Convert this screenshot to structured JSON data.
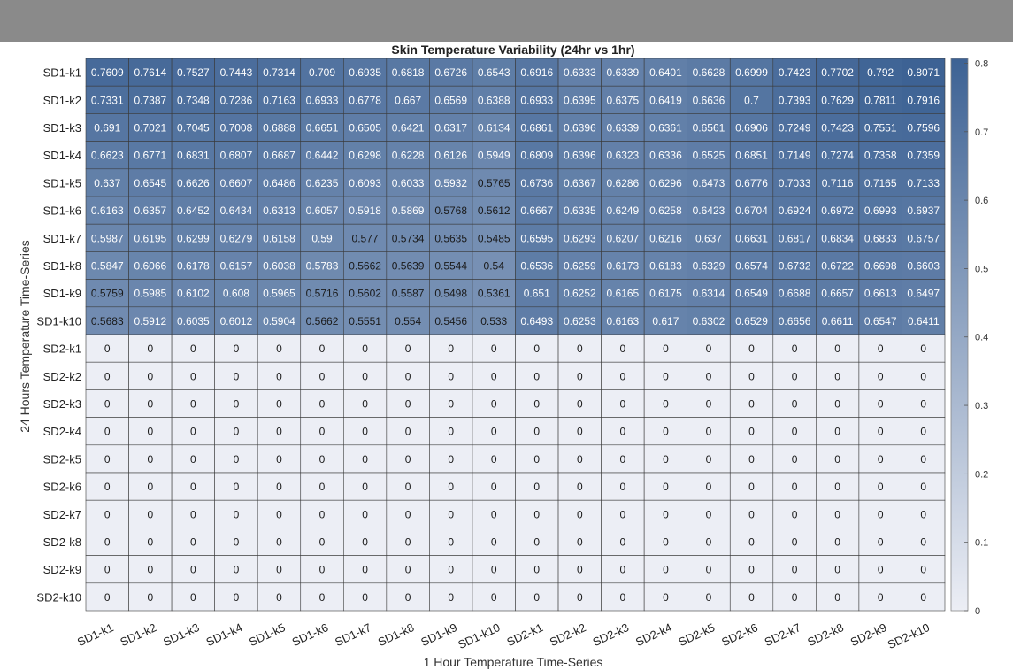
{
  "chart_data": {
    "type": "heatmap",
    "title": "Skin Temperature Variability (24hr vs 1hr)",
    "xlabel": "1 Hour Temperature Time-Series",
    "ylabel": "24 Hours Temperature Time-Series",
    "x_categories": [
      "SD1-k1",
      "SD1-k2",
      "SD1-k3",
      "SD1-k4",
      "SD1-k5",
      "SD1-k6",
      "SD1-k7",
      "SD1-k8",
      "SD1-k9",
      "SD1-k10",
      "SD2-k1",
      "SD2-k2",
      "SD2-k3",
      "SD2-k4",
      "SD2-k5",
      "SD2-k6",
      "SD2-k7",
      "SD2-k8",
      "SD2-k9",
      "SD2-k10"
    ],
    "y_categories": [
      "SD1-k1",
      "SD1-k2",
      "SD1-k3",
      "SD1-k4",
      "SD1-k5",
      "SD1-k6",
      "SD1-k7",
      "SD1-k8",
      "SD1-k9",
      "SD1-k10",
      "SD2-k1",
      "SD2-k2",
      "SD2-k3",
      "SD2-k4",
      "SD2-k5",
      "SD2-k6",
      "SD2-k7",
      "SD2-k8",
      "SD2-k9",
      "SD2-k10"
    ],
    "values": [
      [
        "0.7609",
        "0.7614",
        "0.7527",
        "0.7443",
        "0.7314",
        "0.709",
        "0.6935",
        "0.6818",
        "0.6726",
        "0.6543",
        "0.6916",
        "0.6333",
        "0.6339",
        "0.6401",
        "0.6628",
        "0.6999",
        "0.7423",
        "0.7702",
        "0.792",
        "0.8071"
      ],
      [
        "0.7331",
        "0.7387",
        "0.7348",
        "0.7286",
        "0.7163",
        "0.6933",
        "0.6778",
        "0.667",
        "0.6569",
        "0.6388",
        "0.6933",
        "0.6395",
        "0.6375",
        "0.6419",
        "0.6636",
        "0.7",
        "0.7393",
        "0.7629",
        "0.7811",
        "0.7916"
      ],
      [
        "0.691",
        "0.7021",
        "0.7045",
        "0.7008",
        "0.6888",
        "0.6651",
        "0.6505",
        "0.6421",
        "0.6317",
        "0.6134",
        "0.6861",
        "0.6396",
        "0.6339",
        "0.6361",
        "0.6561",
        "0.6906",
        "0.7249",
        "0.7423",
        "0.7551",
        "0.7596"
      ],
      [
        "0.6623",
        "0.6771",
        "0.6831",
        "0.6807",
        "0.6687",
        "0.6442",
        "0.6298",
        "0.6228",
        "0.6126",
        "0.5949",
        "0.6809",
        "0.6396",
        "0.6323",
        "0.6336",
        "0.6525",
        "0.6851",
        "0.7149",
        "0.7274",
        "0.7358",
        "0.7359"
      ],
      [
        "0.637",
        "0.6545",
        "0.6626",
        "0.6607",
        "0.6486",
        "0.6235",
        "0.6093",
        "0.6033",
        "0.5932",
        "0.5765",
        "0.6736",
        "0.6367",
        "0.6286",
        "0.6296",
        "0.6473",
        "0.6776",
        "0.7033",
        "0.7116",
        "0.7165",
        "0.7133"
      ],
      [
        "0.6163",
        "0.6357",
        "0.6452",
        "0.6434",
        "0.6313",
        "0.6057",
        "0.5918",
        "0.5869",
        "0.5768",
        "0.5612",
        "0.6667",
        "0.6335",
        "0.6249",
        "0.6258",
        "0.6423",
        "0.6704",
        "0.6924",
        "0.6972",
        "0.6993",
        "0.6937"
      ],
      [
        "0.5987",
        "0.6195",
        "0.6299",
        "0.6279",
        "0.6158",
        "0.59",
        "0.577",
        "0.5734",
        "0.5635",
        "0.5485",
        "0.6595",
        "0.6293",
        "0.6207",
        "0.6216",
        "0.637",
        "0.6631",
        "0.6817",
        "0.6834",
        "0.6833",
        "0.6757"
      ],
      [
        "0.5847",
        "0.6066",
        "0.6178",
        "0.6157",
        "0.6038",
        "0.5783",
        "0.5662",
        "0.5639",
        "0.5544",
        "0.54",
        "0.6536",
        "0.6259",
        "0.6173",
        "0.6183",
        "0.6329",
        "0.6574",
        "0.6732",
        "0.6722",
        "0.6698",
        "0.6603"
      ],
      [
        "0.5759",
        "0.5985",
        "0.6102",
        "0.608",
        "0.5965",
        "0.5716",
        "0.5602",
        "0.5587",
        "0.5498",
        "0.5361",
        "0.651",
        "0.6252",
        "0.6165",
        "0.6175",
        "0.6314",
        "0.6549",
        "0.6688",
        "0.6657",
        "0.6613",
        "0.6497"
      ],
      [
        "0.5683",
        "0.5912",
        "0.6035",
        "0.6012",
        "0.5904",
        "0.5662",
        "0.5551",
        "0.554",
        "0.5456",
        "0.533",
        "0.6493",
        "0.6253",
        "0.6163",
        "0.617",
        "0.6302",
        "0.6529",
        "0.6656",
        "0.6611",
        "0.6547",
        "0.6411"
      ],
      [
        "0",
        "0",
        "0",
        "0",
        "0",
        "0",
        "0",
        "0",
        "0",
        "0",
        "0",
        "0",
        "0",
        "0",
        "0",
        "0",
        "0",
        "0",
        "0",
        "0"
      ],
      [
        "0",
        "0",
        "0",
        "0",
        "0",
        "0",
        "0",
        "0",
        "0",
        "0",
        "0",
        "0",
        "0",
        "0",
        "0",
        "0",
        "0",
        "0",
        "0",
        "0"
      ],
      [
        "0",
        "0",
        "0",
        "0",
        "0",
        "0",
        "0",
        "0",
        "0",
        "0",
        "0",
        "0",
        "0",
        "0",
        "0",
        "0",
        "0",
        "0",
        "0",
        "0"
      ],
      [
        "0",
        "0",
        "0",
        "0",
        "0",
        "0",
        "0",
        "0",
        "0",
        "0",
        "0",
        "0",
        "0",
        "0",
        "0",
        "0",
        "0",
        "0",
        "0",
        "0"
      ],
      [
        "0",
        "0",
        "0",
        "0",
        "0",
        "0",
        "0",
        "0",
        "0",
        "0",
        "0",
        "0",
        "0",
        "0",
        "0",
        "0",
        "0",
        "0",
        "0",
        "0"
      ],
      [
        "0",
        "0",
        "0",
        "0",
        "0",
        "0",
        "0",
        "0",
        "0",
        "0",
        "0",
        "0",
        "0",
        "0",
        "0",
        "0",
        "0",
        "0",
        "0",
        "0"
      ],
      [
        "0",
        "0",
        "0",
        "0",
        "0",
        "0",
        "0",
        "0",
        "0",
        "0",
        "0",
        "0",
        "0",
        "0",
        "0",
        "0",
        "0",
        "0",
        "0",
        "0"
      ],
      [
        "0",
        "0",
        "0",
        "0",
        "0",
        "0",
        "0",
        "0",
        "0",
        "0",
        "0",
        "0",
        "0",
        "0",
        "0",
        "0",
        "0",
        "0",
        "0",
        "0"
      ],
      [
        "0",
        "0",
        "0",
        "0",
        "0",
        "0",
        "0",
        "0",
        "0",
        "0",
        "0",
        "0",
        "0",
        "0",
        "0",
        "0",
        "0",
        "0",
        "0",
        "0"
      ],
      [
        "0",
        "0",
        "0",
        "0",
        "0",
        "0",
        "0",
        "0",
        "0",
        "0",
        "0",
        "0",
        "0",
        "0",
        "0",
        "0",
        "0",
        "0",
        "0",
        "0"
      ]
    ],
    "colorbar": {
      "range": [
        0,
        0.8071
      ],
      "ticks": [
        "0",
        "0.1",
        "0.2",
        "0.3",
        "0.4",
        "0.5",
        "0.6",
        "0.7",
        "0.8"
      ],
      "color_low": "#eceef5",
      "color_high": "#3d6294"
    },
    "grid": true
  }
}
